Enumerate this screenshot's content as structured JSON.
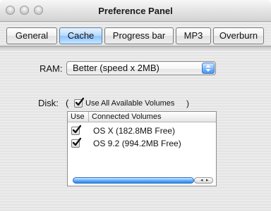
{
  "window": {
    "title": "Preference Panel"
  },
  "titlebar": {
    "buttons": [
      {
        "icon": "close-icon"
      },
      {
        "icon": "minimize-icon"
      },
      {
        "icon": "zoom-icon"
      }
    ]
  },
  "tabs": [
    {
      "label": "General",
      "active": false
    },
    {
      "label": "Cache",
      "active": true
    },
    {
      "label": "Progress bar",
      "active": false
    },
    {
      "label": "MP3",
      "active": false
    },
    {
      "label": "Overburn",
      "active": false
    }
  ],
  "ram": {
    "label": "RAM:",
    "selected": "Better (speed x 2MB)",
    "accent": "#4b93f1"
  },
  "disk": {
    "label": "Disk:",
    "open_paren": "(",
    "close_paren": ")",
    "use_all_label": "Use All Available Volumes",
    "use_all_checked": true,
    "table": {
      "columns": [
        "Use",
        "Connected Volumes"
      ],
      "rows": [
        {
          "checked": true,
          "name": "OS X (182.8MB Free)"
        },
        {
          "checked": true,
          "name": "OS 9.2 (994.2MB Free)"
        }
      ],
      "scroll_arrows": {
        "left": "◂",
        "right": "▸"
      }
    }
  }
}
